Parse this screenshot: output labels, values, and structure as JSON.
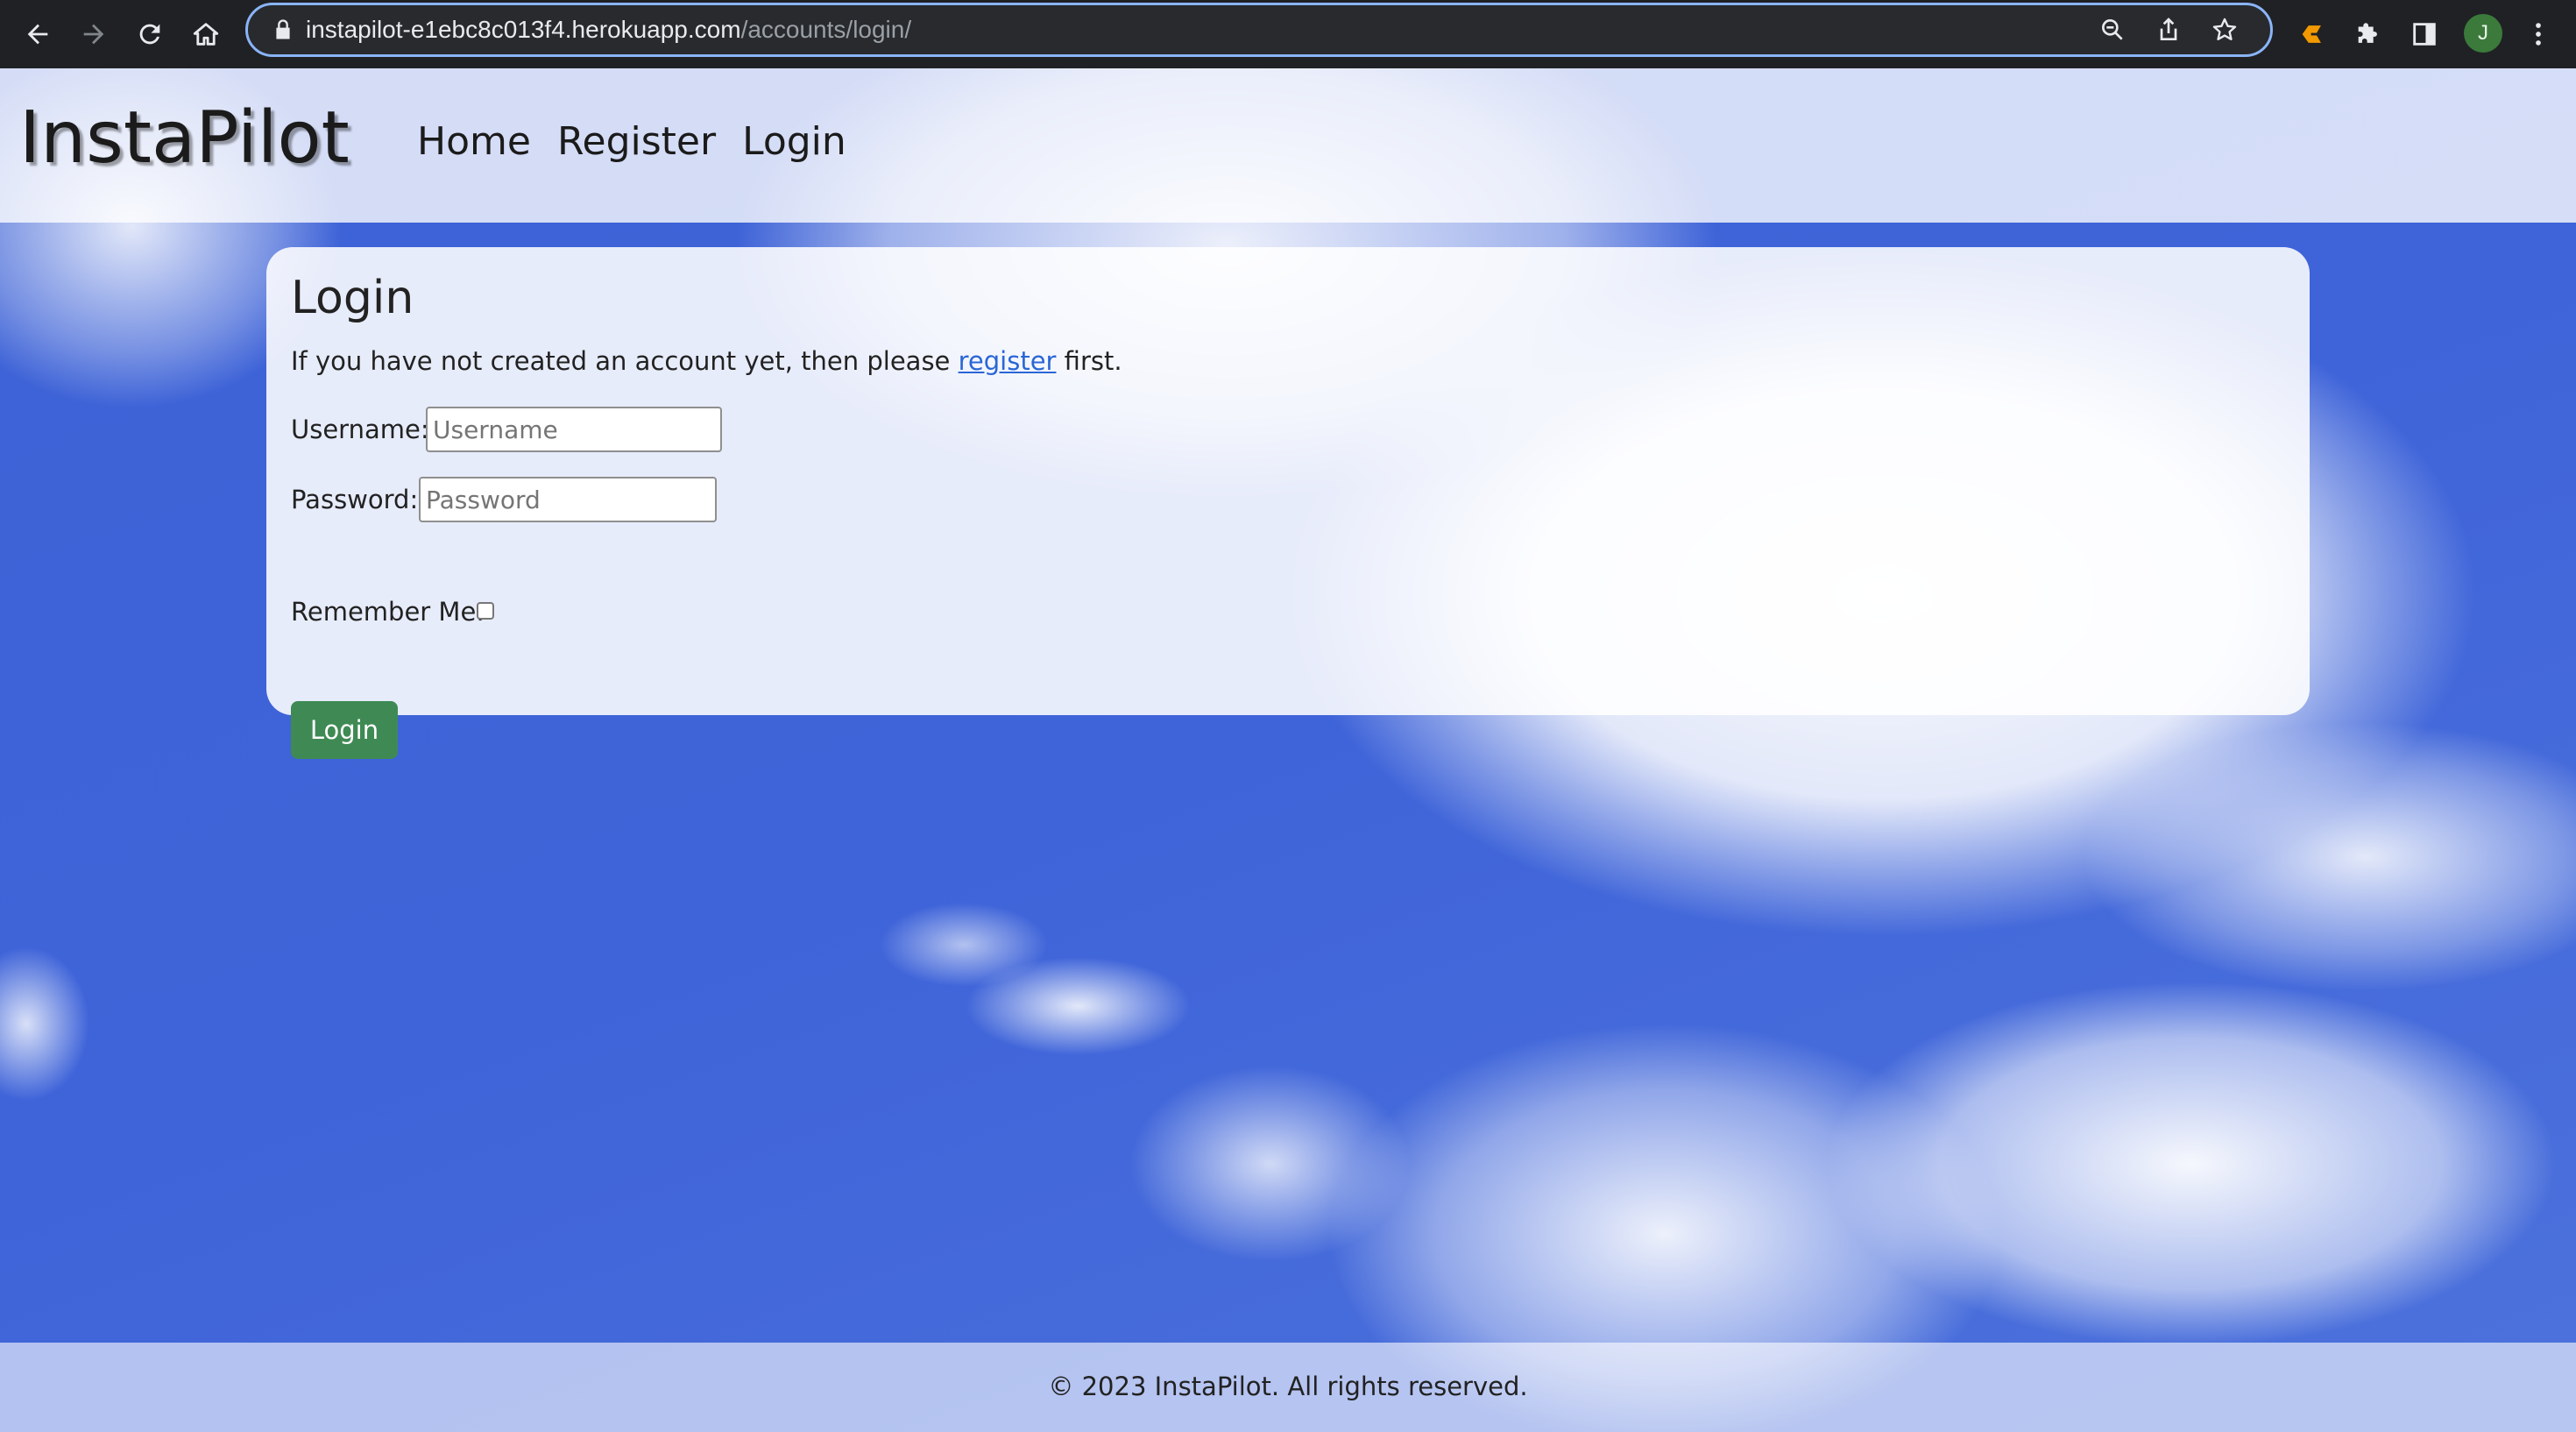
{
  "browser": {
    "url_host": "instapilot-e1ebc8c013f4.herokuapp.com",
    "url_path": "/accounts/login/",
    "profile_initial": "J",
    "icons": [
      "back-icon",
      "forward-icon",
      "reload-icon",
      "home-icon",
      "lock-icon",
      "zoom-icon",
      "share-icon",
      "star-icon",
      "extension-g-icon",
      "puzzle-icon",
      "sidepanel-icon",
      "avatar",
      "more-icon"
    ]
  },
  "header": {
    "brand": "InstaPilot",
    "nav": [
      "Home",
      "Register",
      "Login"
    ]
  },
  "login": {
    "title": "Login",
    "intro_before": "If you have not created an account yet, then please ",
    "intro_link": "register",
    "intro_after": " first.",
    "username_label": "Username:",
    "username_placeholder": "Username",
    "password_label": "Password:",
    "password_placeholder": "Password",
    "remember_label": "Remember Me:",
    "remember_checked": false,
    "button_label": "Login"
  },
  "footer": {
    "text": "© 2023 InstaPilot. All rights reserved."
  },
  "colors": {
    "button": "#3f8a54",
    "link": "#2a66d6",
    "sky": "#3f64d9",
    "chrome": "#202124",
    "omnibox_border": "#8ab4f8"
  }
}
